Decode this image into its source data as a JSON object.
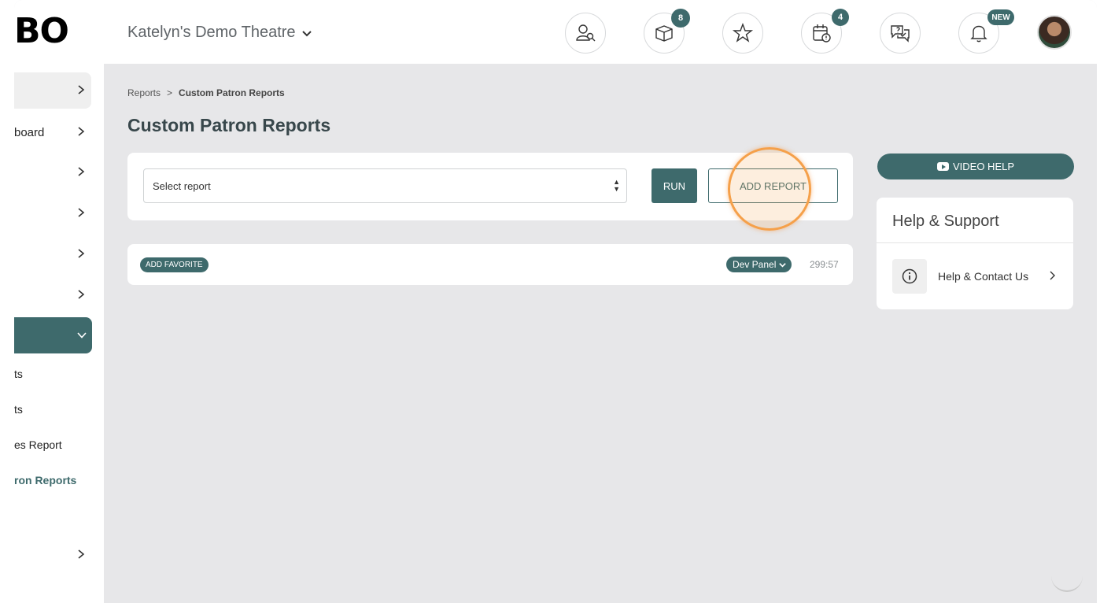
{
  "header": {
    "logo_text": "BO",
    "theatre_name": "Katelyn's Demo Theatre",
    "icons": [
      {
        "name": "patron-search-icon",
        "badge": ""
      },
      {
        "name": "box-icon",
        "badge": "8"
      },
      {
        "name": "star-icon",
        "badge": ""
      },
      {
        "name": "calendar-alert-icon",
        "badge": "4"
      },
      {
        "name": "help-chat-icon",
        "badge": ""
      },
      {
        "name": "bell-icon",
        "badge": "NEW"
      }
    ]
  },
  "sidebar": {
    "items": [
      {
        "label": ""
      },
      {
        "label": "board"
      },
      {
        "label": ""
      },
      {
        "label": ""
      },
      {
        "label": ""
      },
      {
        "label": ""
      },
      {
        "label": ""
      }
    ],
    "sub_items": [
      {
        "label": "ts"
      },
      {
        "label": "ts"
      },
      {
        "label": "es Report"
      },
      {
        "label": "ron Reports"
      }
    ]
  },
  "breadcrumb": {
    "root": "Reports",
    "separator": ">",
    "current": "Custom Patron Reports"
  },
  "page_title": "Custom Patron Reports",
  "report_controls": {
    "select_placeholder": "Select report",
    "run_label": "RUN",
    "add_report_label": "ADD REPORT"
  },
  "favorites_bar": {
    "add_favorite_label": "ADD FAVORITE",
    "dev_panel_label": "Dev Panel",
    "timer": "299:57"
  },
  "help": {
    "video_help_label": "VIDEO HELP",
    "title": "Help & Support",
    "contact_label": "Help & Contact Us"
  },
  "colors": {
    "accent": "#3e6a6c",
    "highlight": "#f5a04a"
  }
}
